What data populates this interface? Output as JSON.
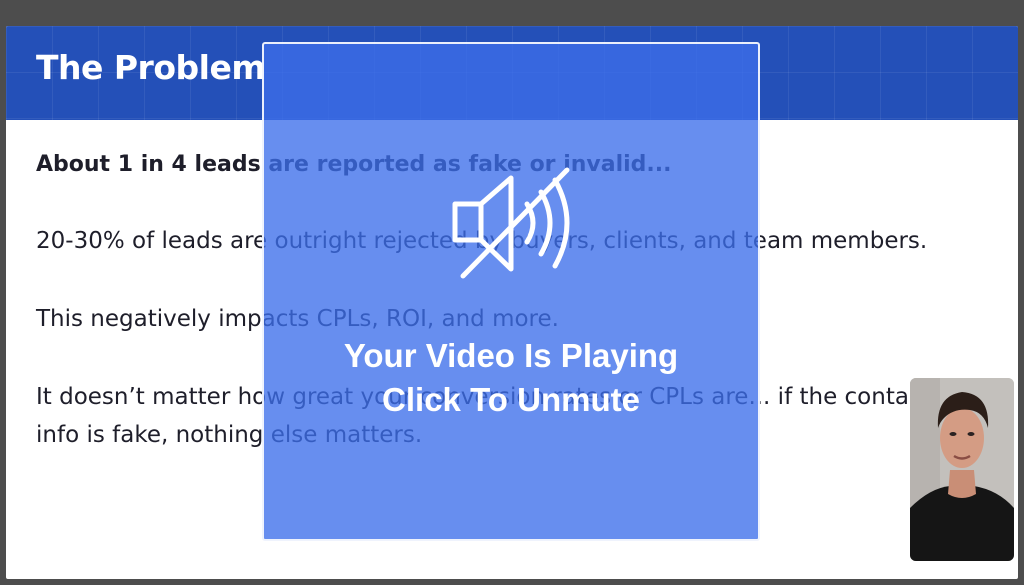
{
  "slide": {
    "title": "The Problem",
    "paragraphs": [
      "About 1 in 4 leads are reported as fake or invalid...",
      "20-30% of leads are outright rejected by buyers, clients, and team members.",
      "This negatively impacts CPLs, ROI, and more.",
      "It doesn’t matter how great your conversion rates or CPLs are... if the contact info is fake, nothing else matters."
    ]
  },
  "overlay": {
    "line1": "Your Video Is Playing",
    "line2": "Click To Unmute",
    "icon": "speaker-muted-icon"
  },
  "presenter": {
    "icon": "presenter-video"
  },
  "colors": {
    "header": "#2450b8",
    "overlay": "#3c6eeb",
    "text": "#1e1e2a"
  }
}
